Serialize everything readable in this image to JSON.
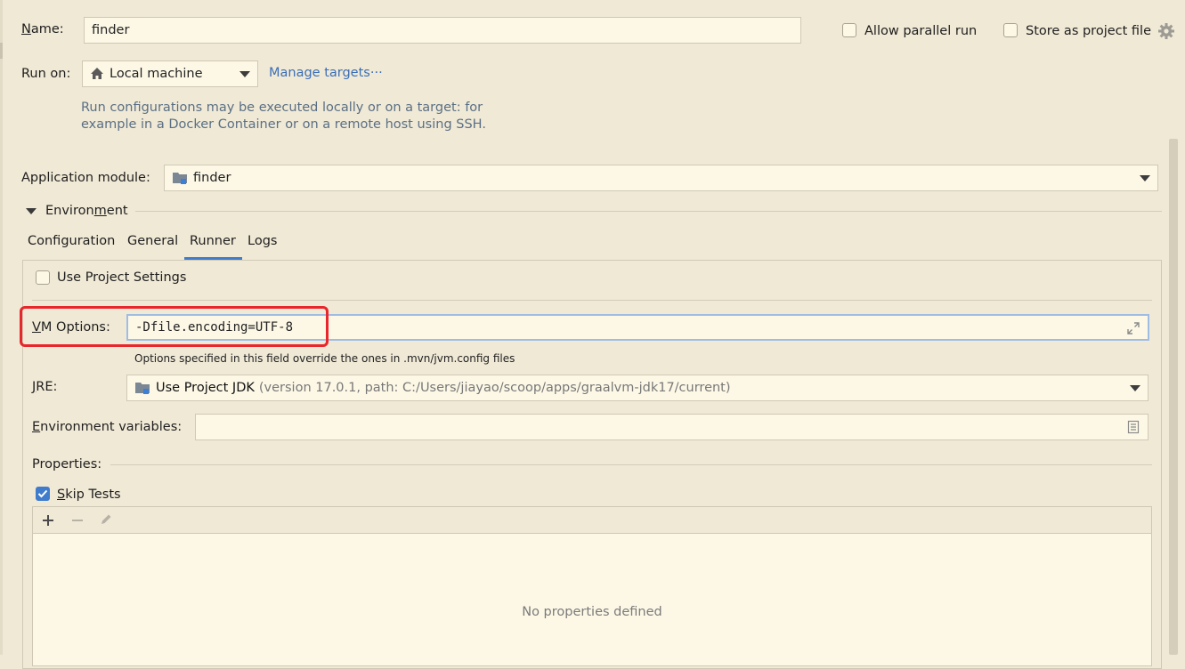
{
  "name_label": "Name:",
  "name_value": "finder",
  "allow_parallel_label": "Allow parallel run",
  "store_project_label": "Store as project file",
  "run_on_label": "Run on:",
  "run_on_value": "Local machine",
  "manage_targets_label": "Manage targets···",
  "run_on_hint_line1": "Run configurations may be executed locally or on a target: for",
  "run_on_hint_line2": "example in a Docker Container or on a remote host using SSH.",
  "module_label": "Application module:",
  "module_value": "finder",
  "environment_label": "Environment",
  "tabs": [
    "Configuration",
    "General",
    "Runner",
    "Logs"
  ],
  "active_tab": "Runner",
  "use_project_settings_label": "Use Project Settings",
  "vm_options_label": "VM Options:",
  "vm_options_value": "-Dfile.encoding=UTF-8",
  "vm_options_hint": "Options specified in this field override the ones in .mvn/jvm.config files",
  "jre_label": "JRE:",
  "jre_value_main": "Use Project JDK",
  "jre_value_detail": "(version 17.0.1, path: C:/Users/jiayao/scoop/apps/graalvm-jdk17/current)",
  "env_vars_label": "Environment variables:",
  "env_vars_value": "",
  "properties_label": "Properties:",
  "skip_tests_label": "Skip Tests",
  "skip_tests_checked": true,
  "use_project_settings_checked": false,
  "allow_parallel_checked": false,
  "store_project_checked": false,
  "no_properties_text": "No properties defined",
  "colors": {
    "background": "#f0e9d6",
    "field": "#fdf8e6",
    "accent": "#3f7ccb",
    "link": "#3b6fb6",
    "highlight_box": "#e8262b"
  }
}
